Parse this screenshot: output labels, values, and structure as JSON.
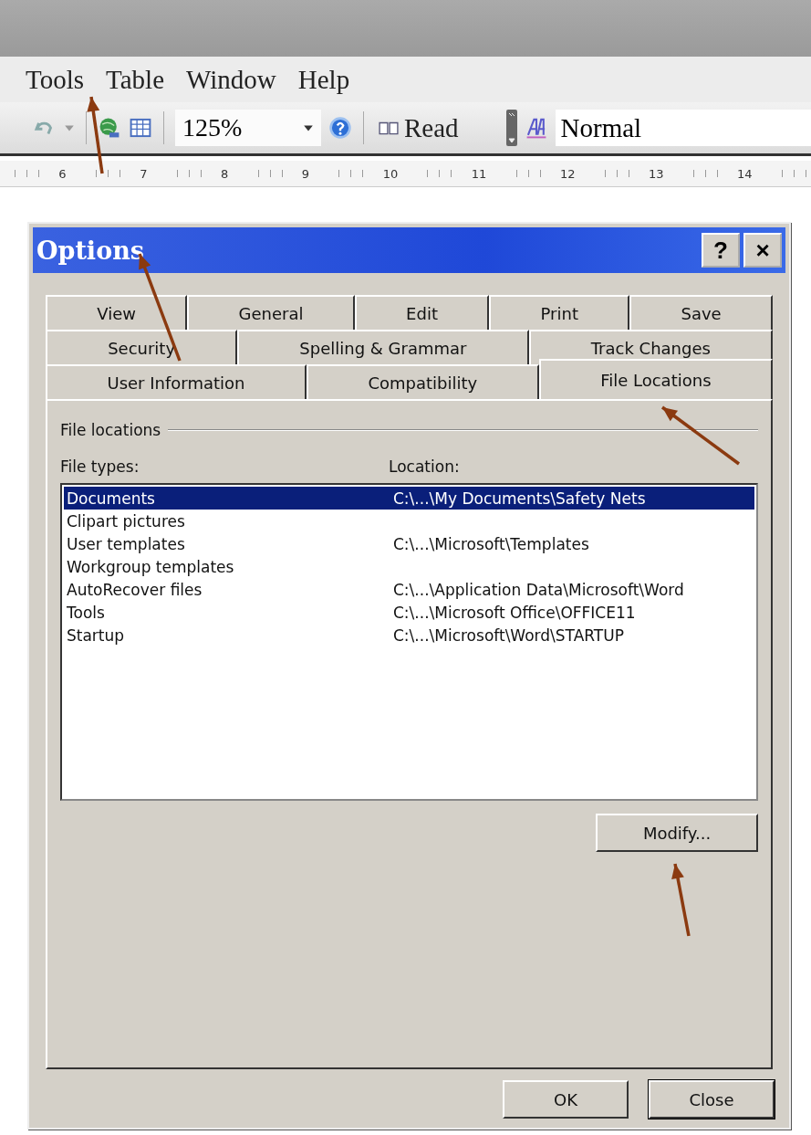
{
  "menu_bar": [
    {
      "label": "Tools"
    },
    {
      "label": "Table"
    },
    {
      "label": "Window"
    },
    {
      "label": "Help"
    }
  ],
  "toolbar": {
    "zoom": "125%",
    "read_button": {
      "label": "Read"
    },
    "style": "Normal"
  },
  "ruler": [
    "6",
    "7",
    "8",
    "9",
    "10",
    "11",
    "12",
    "13",
    "14"
  ],
  "dialog": {
    "title": "Options",
    "title_buttons": [
      "?",
      "×"
    ],
    "tab_rows": [
      [
        {
          "label": "View",
          "selected": false
        },
        {
          "label": "General",
          "selected": false
        },
        {
          "label": "Edit",
          "selected": false
        },
        {
          "label": "Print",
          "selected": false
        },
        {
          "label": "Save",
          "selected": false
        }
      ],
      [
        {
          "label": "Security",
          "selected": false
        },
        {
          "label": "Spelling & Grammar",
          "selected": false
        },
        {
          "label": "Track Changes",
          "selected": false
        }
      ],
      [
        {
          "label": "User Information",
          "selected": false
        },
        {
          "label": "Compatibility",
          "selected": false
        },
        {
          "label": "File Locations",
          "selected": true
        }
      ]
    ],
    "group_label": "File locations",
    "columns": [
      {
        "label": "File types:"
      },
      {
        "label": "Location:"
      }
    ],
    "rows": [
      {
        "type": "Documents",
        "location": "C:\\...\\My Documents\\Safety Nets",
        "selected": true
      },
      {
        "type": "Clipart pictures",
        "selected": false
      },
      {
        "type": "User templates",
        "location": "C:\\...\\Microsoft\\Templates",
        "selected": false
      },
      {
        "type": "Workgroup templates",
        "selected": false
      },
      {
        "type": "AutoRecover files",
        "location": "C:\\...\\Application Data\\Microsoft\\Word",
        "selected": false
      },
      {
        "type": "Tools",
        "location": "C:\\...\\Microsoft Office\\OFFICE11",
        "selected": false
      },
      {
        "type": "Startup",
        "location": "C:\\...\\Microsoft\\Word\\STARTUP",
        "selected": false
      }
    ],
    "modify_button": {
      "label": "Modify..."
    },
    "buttons": [
      "OK",
      "Close"
    ]
  }
}
